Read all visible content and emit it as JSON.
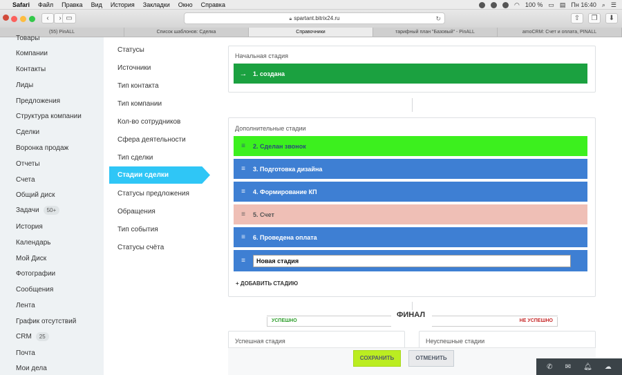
{
  "menubar": {
    "app": "Safari",
    "items": [
      "Файл",
      "Правка",
      "Вид",
      "История",
      "Закладки",
      "Окно",
      "Справка"
    ],
    "battery": "100 %",
    "time": "Пн 16:40"
  },
  "browser": {
    "url": "spartant.bitrix24.ru",
    "tabs": [
      {
        "label": "(55) PinALL"
      },
      {
        "label": "Список шаблонов: Сделка"
      },
      {
        "label": "Справочники"
      },
      {
        "label": "тарифный план \"Базовый\" - PinALL"
      },
      {
        "label": "amoCRM: Счет и оплата, PINALL"
      }
    ]
  },
  "sidebar": {
    "items": [
      {
        "label": "Товары"
      },
      {
        "label": "Компании"
      },
      {
        "label": "Контакты"
      },
      {
        "label": "Лиды"
      },
      {
        "label": "Предложения"
      },
      {
        "label": "Структура компании"
      },
      {
        "label": "Сделки"
      },
      {
        "label": "Воронка продаж"
      },
      {
        "label": "Отчеты"
      },
      {
        "label": "Счета"
      },
      {
        "label": "Общий диск"
      },
      {
        "label": "Задачи",
        "badge": "50+"
      },
      {
        "label": "История"
      },
      {
        "label": "Календарь"
      },
      {
        "label": "Мой Диск"
      },
      {
        "label": "Фотографии"
      },
      {
        "label": "Сообщения"
      },
      {
        "label": "Лента"
      },
      {
        "label": "График отсутствий"
      },
      {
        "label": "CRM",
        "badge": "25"
      },
      {
        "label": "Почта"
      },
      {
        "label": "Мои дела"
      }
    ]
  },
  "subnav": {
    "items": [
      "Статусы",
      "Источники",
      "Тип контакта",
      "Тип компании",
      "Кол-во сотрудников",
      "Сфера деятельности",
      "Тип сделки",
      "Стадии сделки",
      "Статусы предложения",
      "Обращения",
      "Тип события",
      "Статусы счёта"
    ],
    "active": "Стадии сделки"
  },
  "initial": {
    "label": "Начальная стадия",
    "stage": {
      "label": "1. создана",
      "color": "#1ba140"
    }
  },
  "additional": {
    "label": "Дополнительные стадии",
    "stages": [
      {
        "label": "2. Сделан звонок",
        "color": "#3cf01e",
        "text_color": "#2b4a7a"
      },
      {
        "label": "3. Подготовка дизайна",
        "color": "#3e7fd3",
        "text_color": "#ffffff"
      },
      {
        "label": "4. Формирование КП",
        "color": "#3e7fd3",
        "text_color": "#ffffff"
      },
      {
        "label": "5. Счет",
        "color": "#efbfb6",
        "text_color": "#555555"
      },
      {
        "label": "6. Проведена оплата",
        "color": "#3e7fd3",
        "text_color": "#ffffff"
      }
    ],
    "new_stage_value": "Новая стадия",
    "new_stage_color": "#3e7fd3",
    "add_label": "+ ДОБАВИТЬ СТАДИЮ"
  },
  "final": {
    "title": "ФИНАЛ",
    "success": "УСПЕШНО",
    "failure": "НЕ УСПЕШНО",
    "success_card": "Успешная стадия",
    "failure_card": "Неуспешные стадии"
  },
  "footer": {
    "save": "СОХРАНИТЬ",
    "cancel": "ОТМЕНИТЬ"
  }
}
